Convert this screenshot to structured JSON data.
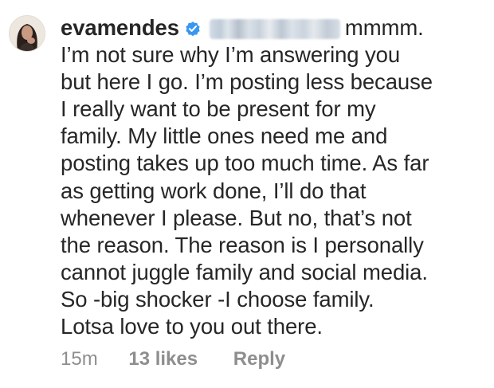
{
  "comment": {
    "username": "evamendes",
    "verified_icon": "verified-badge-icon",
    "mention_icon": "blurred-mention",
    "first_line_tail": "mmmm.",
    "lines": [
      "I’m not sure why I’m answering you",
      "but here I go. I’m posting less because",
      "I really want to be present for my",
      "family. My little ones need me and",
      "posting takes up too much time. As far",
      "as getting work done, I’ll do that",
      "whenever I please. But no, that’s not",
      "the reason. The reason is I personally",
      "cannot juggle family and social media.",
      "So -big shocker -I choose family.",
      "Lotsa love to you out there."
    ],
    "time": "15m",
    "likes": "13 likes",
    "reply_label": "Reply"
  },
  "colors": {
    "text": "#262626",
    "muted": "#8e8e8e",
    "verified_blue": "#3897f0",
    "background": "#ffffff"
  }
}
